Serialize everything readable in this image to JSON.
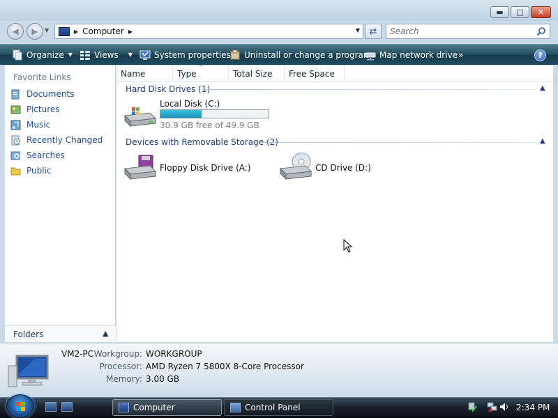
{
  "navigation": {
    "address_crumbs": [
      "Computer"
    ],
    "search_placeholder": "Search"
  },
  "commands": {
    "organize": "Organize",
    "views": "Views",
    "system_properties": "System properties",
    "uninstall": "Uninstall or change a program",
    "map_network_drive": "Map network drive",
    "more": "»",
    "help": "?"
  },
  "favorite_links": {
    "title": "Favorite Links",
    "items": [
      {
        "label": "Documents",
        "icon": "documents-icon"
      },
      {
        "label": "Pictures",
        "icon": "pictures-icon"
      },
      {
        "label": "Music",
        "icon": "music-icon"
      },
      {
        "label": "Recently Changed",
        "icon": "recently-changed-icon"
      },
      {
        "label": "Searches",
        "icon": "searches-icon"
      },
      {
        "label": "Public",
        "icon": "public-folder-icon"
      }
    ],
    "folders_label": "Folders"
  },
  "columns": [
    "Name",
    "Type",
    "Total Size",
    "Free Space"
  ],
  "groups": {
    "hard_disks": {
      "title": "Hard Disk Drives (1)",
      "drives": [
        {
          "label": "Local Disk (C:)",
          "free_text": "30.9 GB free of 49.9 GB",
          "used_fraction": 0.38
        }
      ]
    },
    "removable": {
      "title": "Devices with Removable Storage (2)",
      "drives": [
        {
          "label": "Floppy Disk Drive (A:)"
        },
        {
          "label": "CD Drive (D:)"
        }
      ]
    }
  },
  "details": {
    "pc_name": "VM2-PC",
    "workgroup_label": "Workgroup:",
    "workgroup": "WORKGROUP",
    "processor_label": "Processor:",
    "processor": "AMD Ryzen 7 5800X 8-Core Processor",
    "memory_label": "Memory:",
    "memory": "3.00 GB"
  },
  "taskbar": {
    "tasks": [
      "Computer",
      "Control Panel"
    ],
    "clock": "2:34 PM"
  },
  "colors": {
    "accent_link": "#1f4ea0",
    "command_bar": "#264e60",
    "progress_fill": "#1a8fb6"
  }
}
